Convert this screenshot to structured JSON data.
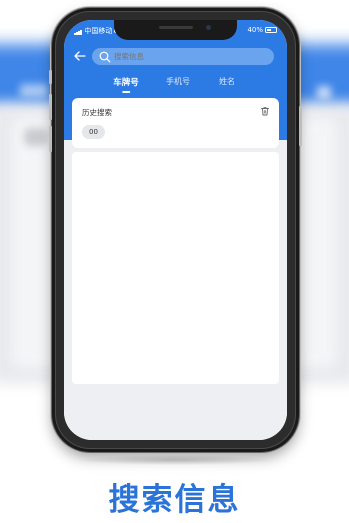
{
  "colors": {
    "primary": "#2c7be5",
    "background": "#eeeff3",
    "caption": "#2a73d8"
  },
  "status_bar": {
    "carrier": "中国移动",
    "battery": "40%"
  },
  "search": {
    "placeholder": "搜索信息",
    "back_icon": "arrow-left-icon",
    "search_icon": "magnifier-icon"
  },
  "tabs": [
    {
      "label": "车牌号",
      "active": true
    },
    {
      "label": "手机号",
      "active": false
    },
    {
      "label": "姓名",
      "active": false
    }
  ],
  "history": {
    "title": "历史搜索",
    "clear_icon": "trash-icon",
    "items": [
      "00"
    ]
  },
  "caption": "搜索信息"
}
